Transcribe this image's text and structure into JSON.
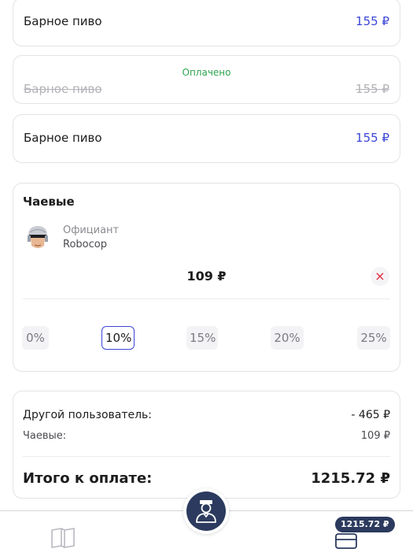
{
  "order_items": [
    {
      "name": "Барное пиво",
      "price": "155 ₽",
      "paid": false
    },
    {
      "name": "Барное пиво",
      "price": "155 ₽",
      "paid": true,
      "paid_label": "Оплачено"
    },
    {
      "name": "Барное пиво",
      "price": "155 ₽",
      "paid": false
    }
  ],
  "tips": {
    "title": "Чаевые",
    "waiter_role": "Официант",
    "waiter_name": "Robocop",
    "amount": "109 ₽",
    "clear_icon": "×",
    "options": [
      "0%",
      "10%",
      "15%",
      "20%",
      "25%"
    ],
    "selected_option": "10%"
  },
  "summary": {
    "other_user_label": "Другой пользователь:",
    "other_user_value": "- 465 ₽",
    "tips_label": "Чаевые:",
    "tips_value": "109 ₽",
    "total_label": "Итого к оплате:",
    "total_value": "1215.72 ₽"
  },
  "bottom_bar": {
    "menu_icon": "book-icon",
    "center_icon": "waiter-icon",
    "wallet_icon": "wallet-icon",
    "wallet_badge": "1215.72 ₽"
  },
  "colors": {
    "accent": "#3b46d6",
    "paid": "#2ea44f",
    "dark": "#2b3a5e",
    "danger": "#e0283a"
  }
}
